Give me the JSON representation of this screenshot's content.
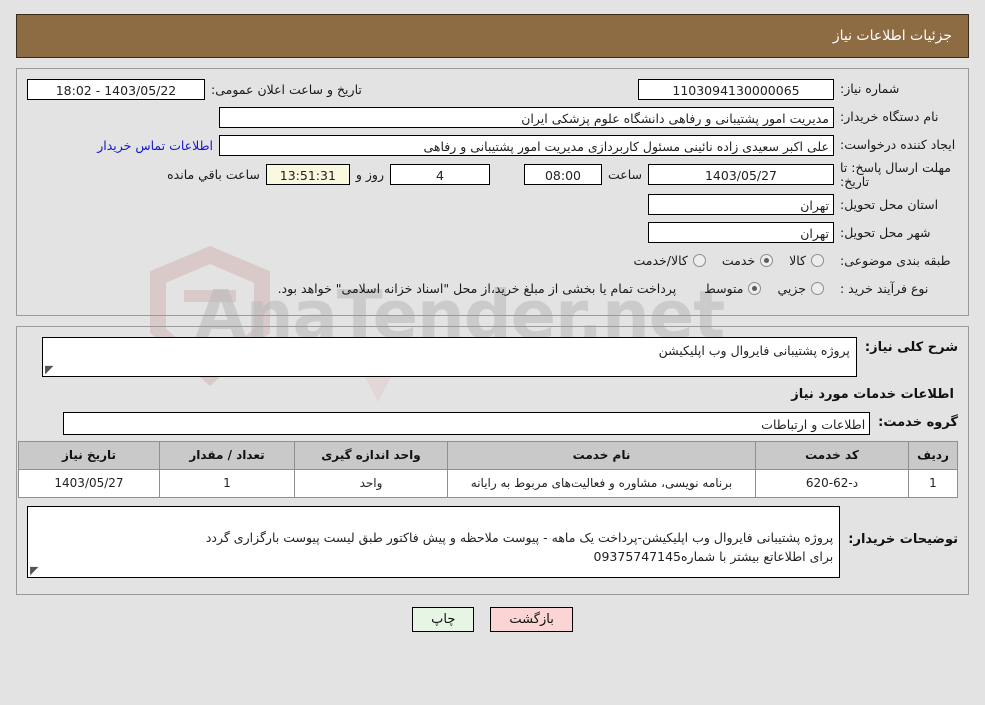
{
  "header": {
    "title": "جزئیات اطلاعات نیاز"
  },
  "labels": {
    "need_number": "شماره نیاز:",
    "buyer_org": "نام دستگاه خریدار:",
    "request_creator": "ایجاد کننده درخواست:",
    "response_deadline": "مهلت ارسال پاسخ: تا تاریخ:",
    "public_announce": "تاریخ و ساعت اعلان عمومی:",
    "delivery_province": "استان محل تحویل:",
    "delivery_city": "شهر محل تحویل:",
    "subject_category": "طبقه بندی موضوعی:",
    "purchase_type": "نوع فرآیند خرید :",
    "hour": "ساعت",
    "day_and": "روز و",
    "hours_remaining": "ساعت باقي مانده",
    "contact_link": "اطلاعات تماس خریدار",
    "general_desc": "شرح کلی نیاز:",
    "services_info_title": "اطلاعات خدمات مورد نیاز",
    "service_group": "گروه خدمت:",
    "buyer_notes": "توضیحات خریدار:"
  },
  "values": {
    "need_number": "1103094130000065",
    "buyer_org": "مدیریت امور پشتیبانی و رفاهی دانشگاه علوم پزشکی ایران",
    "request_creator": "علی اکبر سعیدی زاده نائینی مسئول کاربردازی مدیریت امور پشتیبانی و رفاهی",
    "deadline_date": "1403/05/27",
    "deadline_time": "08:00",
    "days_remaining": "4",
    "time_remaining": "13:51:31",
    "public_announce": "1403/05/22 - 18:02",
    "delivery_province": "تهران",
    "delivery_city": "تهران",
    "general_desc": "پروژه پشتیبانی فایروال وب اپلیکیشن",
    "service_group": "اطلاعات و ارتباطات",
    "buyer_notes": "پروژه پشتیبانی فایروال وب اپلیکیشن-پرداخت یک ماهه - پیوست ملاحظه و پیش فاکتور طبق لیست پیوست بارگزاری گردد\nبرای اطلاعاتع بیشتر با شماره09375747145"
  },
  "subject_category": {
    "options": [
      {
        "label": "کالا",
        "selected": false
      },
      {
        "label": "خدمت",
        "selected": true
      },
      {
        "label": "کالا/خدمت",
        "selected": false
      }
    ]
  },
  "purchase_type": {
    "options": [
      {
        "label": "جزیي",
        "selected": false
      },
      {
        "label": "متوسط",
        "selected": true
      }
    ],
    "note": "پرداخت تمام یا بخشی از مبلغ خرید،از محل \"اسناد خزانه اسلامی\" خواهد بود."
  },
  "table": {
    "columns": [
      "ردیف",
      "کد خدمت",
      "نام خدمت",
      "واحد اندازه گیری",
      "تعداد / مقدار",
      "تاریخ نیاز"
    ],
    "rows": [
      {
        "row_no": "1",
        "service_code": "د-62-620",
        "service_name": "برنامه نویسی، مشاوره و فعالیت‌های مربوط به رایانه",
        "unit": "واحد",
        "quantity": "1",
        "need_date": "1403/05/27"
      }
    ]
  },
  "footer": {
    "print_label": "چاپ",
    "back_label": "بازگشت"
  },
  "watermark": {
    "text": "AnaTender.net",
    "text2": ""
  },
  "colors": {
    "header_bg": "#8d6b43",
    "page_bg": "#e3e3e3",
    "link": "#1414d6",
    "highlight_field": "#fbf8e0",
    "print_btn": "#e6f5e4",
    "back_btn": "#fbd5d5",
    "table_header": "#c9c9c9"
  }
}
